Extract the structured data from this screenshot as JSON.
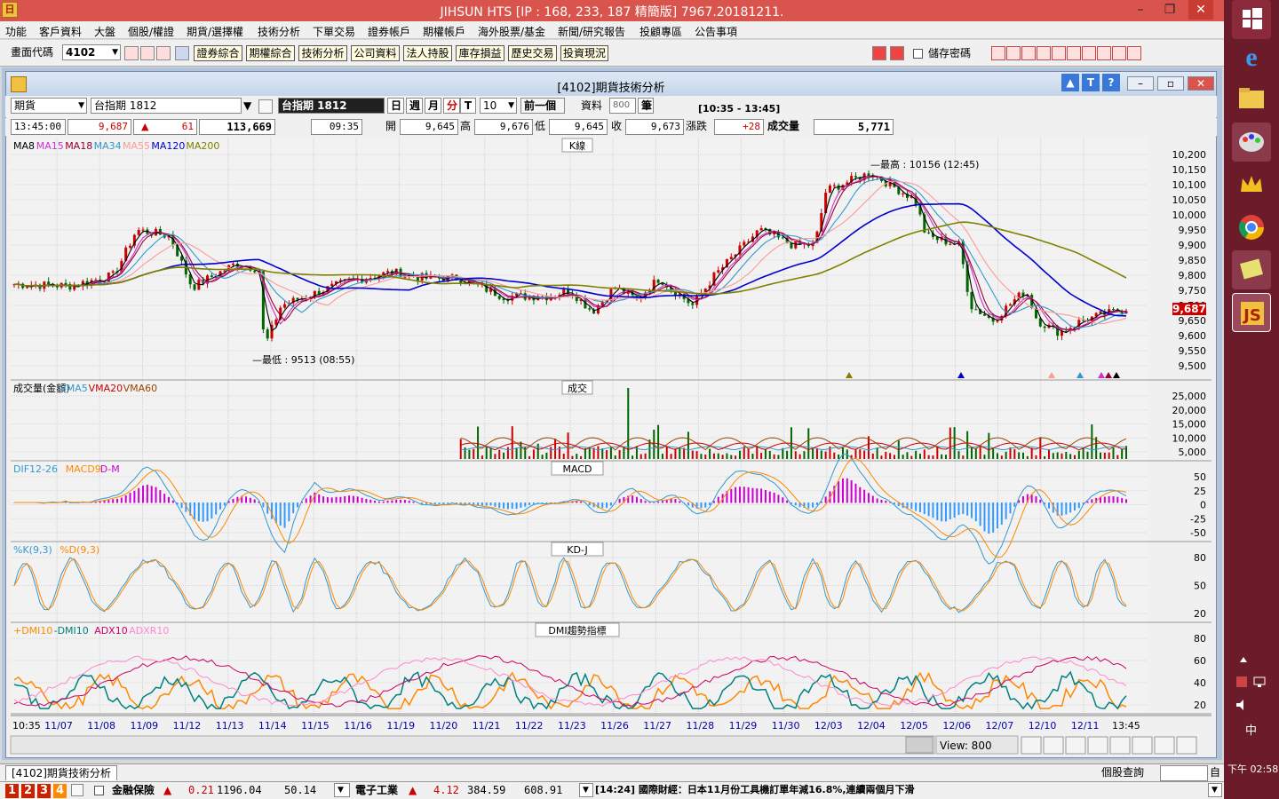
{
  "app": {
    "title": "JIHSUN HTS  [IP : 168, 233, 187 精簡版] 7967.20181211."
  },
  "menu": [
    "功能",
    "客戶資料",
    "大盤",
    "個股/權證",
    "期貨/選擇權",
    "技術分析",
    "下單交易",
    "證券帳戶",
    "期權帳戶",
    "海外股票/基金",
    "新聞/研究報告",
    "投顧專區",
    "公告事項"
  ],
  "toolbar": {
    "code_label": "畫面代碼",
    "code_value": "4102",
    "buttons": [
      "證券綜合",
      "期權綜合",
      "技術分析",
      "公司資料",
      "法人持股",
      "庫存損益",
      "歷史交易",
      "投資現況"
    ],
    "save_pw_label": "儲存密碼"
  },
  "window": {
    "title": "[4102]期貨技術分析"
  },
  "controls": {
    "type": "期貨",
    "contract": "台指期 1812",
    "contract_dark": "台指期 1812",
    "periods": [
      "日",
      "週",
      "月",
      "分"
    ],
    "active_period": "分",
    "t_btn": "T",
    "interval": "10",
    "prev_btn": "前一個",
    "data_label": "資料",
    "data_count": "800",
    "unit": "筆",
    "range": "[10:35 - 13:45]"
  },
  "quote": {
    "time": "13:45:00",
    "price": "9,687",
    "arrow": "▲",
    "change": "61",
    "volume_total": "113,669",
    "bar_time": "09:35",
    "open_label": "開",
    "open": "9,645",
    "high_label": "高",
    "high": "9,676",
    "low_label": "低",
    "low": "9,645",
    "close_label": "收",
    "close": "9,673",
    "chg_label": "漲跌",
    "chg": "+28",
    "vol_label": "成交量",
    "vol": "5,771"
  },
  "panels": {
    "k": {
      "name": "K線",
      "legend": [
        [
          "MA8",
          "#000000"
        ],
        [
          "MA15",
          "#cc33cc"
        ],
        [
          "MA18",
          "#990033"
        ],
        [
          "MA34",
          "#3399cc"
        ],
        [
          "MA55",
          "#ff9999"
        ],
        [
          "MA120",
          "#0000cc"
        ],
        [
          "MA200",
          "#808000"
        ]
      ],
      "y_ticks": [
        "10,200",
        "10,150",
        "10,100",
        "10,050",
        "10,000",
        "9,950",
        "9,900",
        "9,850",
        "9,800",
        "9,750",
        "9,700",
        "9,650",
        "9,600",
        "9,550",
        "9,500"
      ],
      "last_price": "9,687",
      "high_note": "最高 : 10156 (12:45)",
      "low_note": "最低 : 9513 (08:55)"
    },
    "vol": {
      "name": "成交",
      "legend": [
        [
          "成交量(金額)",
          "#000000"
        ],
        [
          "VMA5",
          "#3399cc"
        ],
        [
          "VMA20",
          "#cc0000"
        ],
        [
          "VMA60",
          "#994400"
        ]
      ],
      "y_ticks": [
        "25,000",
        "20,000",
        "15,000",
        "10,000",
        "5,000"
      ]
    },
    "macd": {
      "name": "MACD",
      "legend": [
        [
          "DIF12-26",
          "#3399cc"
        ],
        [
          "MACD9",
          "#ff8800"
        ],
        [
          "D-M",
          "#cc00cc"
        ]
      ],
      "y_ticks": [
        "50",
        "25",
        "0",
        "-25",
        "-50"
      ]
    },
    "kd": {
      "name": "KD-J",
      "legend": [
        [
          "%K(9,3)",
          "#3399cc"
        ],
        [
          "%D(9,3)",
          "#ff8800"
        ]
      ],
      "y_ticks": [
        "80",
        "50",
        "20"
      ]
    },
    "dmi": {
      "name": "DMI趨勢指標",
      "legend": [
        [
          "+DMI10",
          "#ff8800"
        ],
        [
          "-DMI10",
          "#008080"
        ],
        [
          "ADX10",
          "#cc0066"
        ],
        [
          "ADXR10",
          "#ff88cc"
        ]
      ],
      "y_ticks": [
        "80",
        "60",
        "40",
        "20"
      ]
    }
  },
  "x_axis": [
    "10:35",
    "11/07",
    "11/08",
    "11/09",
    "11/12",
    "11/13",
    "11/14",
    "11/15",
    "11/16",
    "11/19",
    "11/20",
    "11/21",
    "11/22",
    "11/23",
    "11/26",
    "11/27",
    "11/28",
    "11/29",
    "11/30",
    "12/03",
    "12/04",
    "12/05",
    "12/06",
    "12/07",
    "12/10",
    "12/11",
    "13:45"
  ],
  "view": {
    "label": "View: 800"
  },
  "bottom": {
    "tab": "[4102]期貨技術分析",
    "query_label": "個股查詢",
    "self_label": "自"
  },
  "ticker": {
    "pages": [
      "1",
      "2",
      "3",
      "4"
    ],
    "i1_name": "金融保險",
    "i1_arrow": "▲",
    "i1_chg": "0.21",
    "i1_val": "1196.04",
    "i1_vol": "50.14",
    "i2_name": "電子工業",
    "i2_arrow": "▲",
    "i2_chg": "4.12",
    "i2_val": "384.59",
    "i2_vol": "608.91",
    "news": "[14:24] 國際財經：日本11月份工具機訂單年減16.8%,連續兩個月下滑"
  },
  "taskbar": {
    "ime": "中",
    "clock": "下午 02:58"
  },
  "colors": {
    "title_bg": "#d9544c",
    "up": "#cc0000",
    "down": "#006600",
    "chart_bg": "#f2f2f2",
    "grid": "#cfcfcf"
  }
}
